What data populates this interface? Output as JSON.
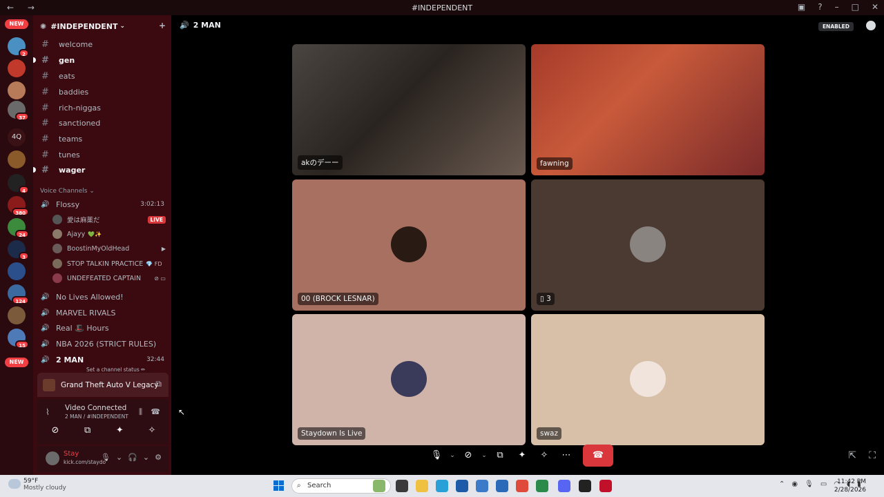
{
  "window": {
    "title": "#INDEPENDENT",
    "nav_icons": "← →"
  },
  "guilds": {
    "new_label_top": "NEW",
    "new_label_bottom": "NEW",
    "text_server": "4Q",
    "badges": [
      "2",
      "37",
      "4",
      "380",
      "24",
      "3",
      "124",
      "15"
    ]
  },
  "server": {
    "name": "#INDEPENDENT",
    "text_channels": [
      {
        "name": "welcome",
        "unread": false
      },
      {
        "name": "gen",
        "unread": true
      },
      {
        "name": "eats",
        "unread": false
      },
      {
        "name": "baddies",
        "unread": false
      },
      {
        "name": "rich-niggas",
        "unread": false
      },
      {
        "name": "sanctioned",
        "unread": false
      },
      {
        "name": "teams",
        "unread": false
      },
      {
        "name": "tunes",
        "unread": false
      },
      {
        "name": "wager",
        "unread": true
      }
    ],
    "voice_category": "Voice Channels",
    "flossy": {
      "name": "Flossy",
      "timer": "3:02:13"
    },
    "flossy_users": [
      {
        "name": "愛は麻薬だ",
        "suffix": "",
        "live": "LIVE"
      },
      {
        "name": "Ajayy",
        "suffix": "💚✨",
        "live": ""
      },
      {
        "name": "BoostinMyOldHead",
        "suffix": "",
        "live": ""
      },
      {
        "name": "STOP TALKIN PRACTICE",
        "suffix": "💎 FD",
        "live": ""
      },
      {
        "name": "UNDEFEATED CAPTAIN",
        "suffix": "",
        "live": ""
      }
    ],
    "voice_channels": [
      {
        "name": "No Lives Allowed!"
      },
      {
        "name": "MARVEL RIVALS"
      },
      {
        "name": "Real 🎩 Hours"
      },
      {
        "name": "NBA 2026 (STRICT RULES)"
      }
    ],
    "current_voice": {
      "name": "2 MAN",
      "timer": "32:44",
      "status": "Set a channel status ✏"
    }
  },
  "activity": {
    "game": "Grand Theft Auto V Legacy"
  },
  "rtc": {
    "title": "Video Connected",
    "sub": "2 MAN / #INDEPENDENT"
  },
  "user": {
    "name": "Stay",
    "sub": "kick.com/staydo"
  },
  "main": {
    "channel": "2 MAN",
    "enabled_label": "ENABLED",
    "tiles": [
      {
        "name": "akのデーー"
      },
      {
        "name": "fawning"
      },
      {
        "name": "00 (BROCK LESNAR)"
      },
      {
        "name": "3"
      },
      {
        "name": "Staydown Is Live"
      },
      {
        "name": "swaz"
      }
    ]
  },
  "taskbar": {
    "temp": "59°F",
    "weather": "Mostly cloudy",
    "search": "Search",
    "time": "11:42 PM",
    "date": "2/28/2026"
  },
  "colors": {
    "sidebar": "#3a0a10",
    "guild_rail": "#2a0a0e",
    "hangup": "#da373c",
    "accent_green": "#23a55a"
  }
}
